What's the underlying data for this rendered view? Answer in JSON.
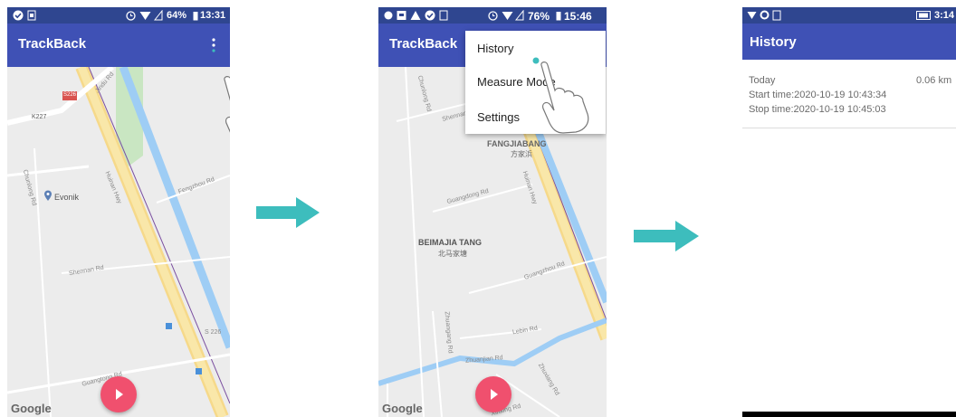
{
  "arrow_color": "#3dbdbd",
  "appbar_color": "#3f51b5",
  "statusbar_color": "#2f4690",
  "screen1": {
    "status": {
      "left_icons": [
        "check-circle-icon",
        "image-icon"
      ],
      "right_icons": [
        "alarm-icon",
        "wifi-icon",
        "signal-icon",
        "battery-icon"
      ],
      "battery": "64%",
      "time": "13:31"
    },
    "app_title": "TrackBack",
    "overflow_icon": "more-vert-icon",
    "map_labels": {
      "road_s226": "S226",
      "jiudu": "Jindu Rd",
      "k227": "K227",
      "chunlong": "Chunlong Rd",
      "fengzhou": "Fengzhou Rd",
      "huinan": "Huinan Hwy",
      "evonik": "Evonik",
      "shennan": "Shennan Rd",
      "s226b": "S 226",
      "guangtong": "Guangtong Rd"
    },
    "google": "Google"
  },
  "screen2": {
    "status": {
      "left_icons": [
        "dot-icon",
        "image-icon",
        "warning-icon",
        "check-circle-icon",
        "image-icon"
      ],
      "right_icons": [
        "alarm-icon",
        "wifi-icon",
        "signal-icon",
        "battery-icon"
      ],
      "battery": "76%",
      "time": "15:46"
    },
    "app_title": "TrackBack",
    "menu": [
      "History",
      "Measure Mode",
      "Settings"
    ],
    "map_labels": {
      "chunlong": "Chunlong Rd",
      "shennan": "Shennan Rd",
      "fangjiabang": "FANGJIABANG",
      "fangjiabang_cn": "方家浜",
      "huinan": "Huinan Hwy",
      "guangdong": "Guangdong Rd",
      "beimajia": "BEIMAJIA TANG",
      "beimajia_cn": "北马家塘",
      "guangzhou": "Guangzhou Rd",
      "zhuangang": "Zhuangang Rd",
      "lebin": "Lebin Rd",
      "zhuanjian": "Zhuanjian Rd",
      "zhuxiang": "Zhuxiang Rd",
      "xinxing": "Xinxing Rd",
      "google": "Google"
    }
  },
  "screen3": {
    "status": {
      "left_icons": [
        "wifi-icon",
        "gear-icon",
        "image-icon"
      ],
      "right_icons": [
        "battery-icon"
      ],
      "time": "3:14"
    },
    "app_title": "History",
    "entry": {
      "date": "Today",
      "distance": "0.06 km",
      "start": "Start time:2020-10-19 10:43:34",
      "stop": "Stop time:2020-10-19 10:45:03"
    }
  }
}
